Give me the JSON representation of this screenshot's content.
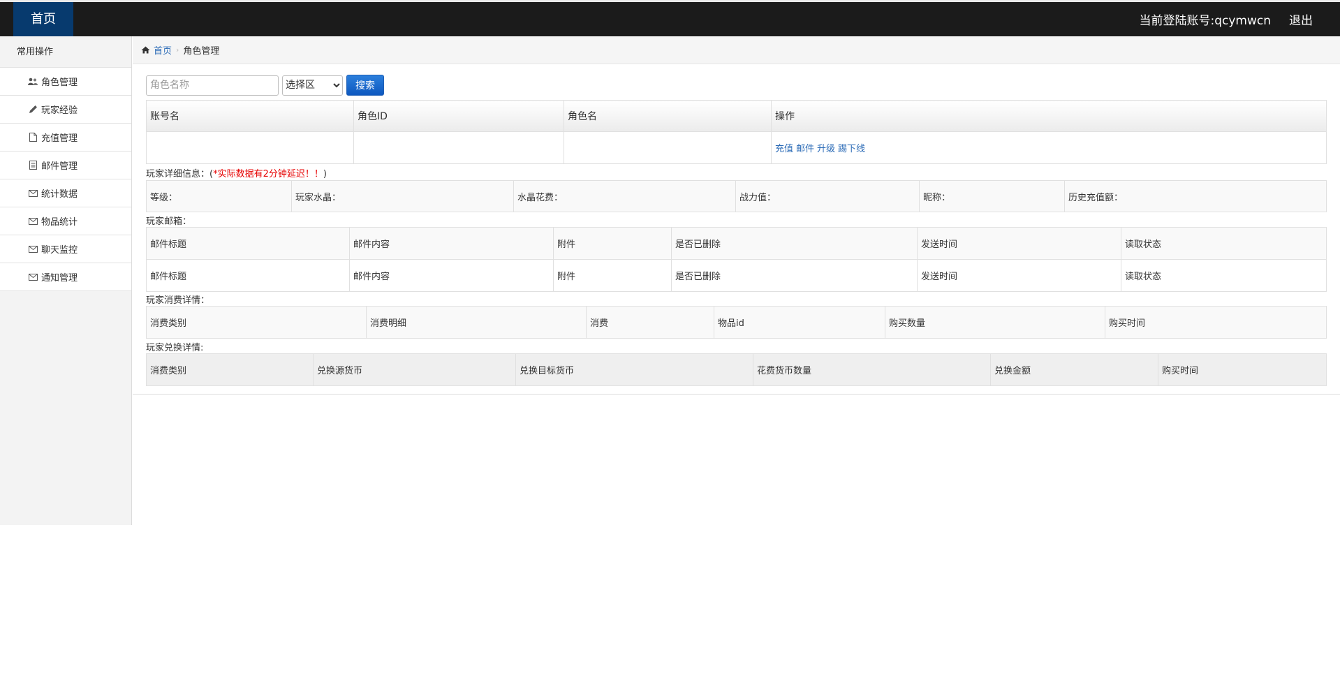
{
  "topbar": {
    "brand": "首页",
    "account": "当前登陆账号:qcymwcn",
    "logout": "退出"
  },
  "sidebar": {
    "header": "常用操作",
    "items": [
      {
        "label": "角色管理",
        "icon": "users-icon"
      },
      {
        "label": "玩家经验",
        "icon": "pencil-icon"
      },
      {
        "label": "充值管理",
        "icon": "file-icon"
      },
      {
        "label": "邮件管理",
        "icon": "list-icon"
      },
      {
        "label": "统计数据",
        "icon": "envelope-icon"
      },
      {
        "label": "物品统计",
        "icon": "envelope-icon"
      },
      {
        "label": "聊天监控",
        "icon": "envelope-icon"
      },
      {
        "label": "通知管理",
        "icon": "envelope-icon"
      }
    ]
  },
  "breadcrumb": {
    "home": "首页",
    "current": "角色管理"
  },
  "search": {
    "placeholder": "角色名称",
    "select_value": "选择区",
    "button": "搜索"
  },
  "role_table": {
    "headers": [
      "账号名",
      "角色ID",
      "角色名",
      "操作"
    ],
    "actions": [
      "充值",
      "邮件",
      "升级",
      "踢下线"
    ]
  },
  "detail": {
    "label_prefix": "玩家详细信息：(",
    "label_warning": "*实际数据有2分钟延迟！！",
    "label_suffix": ")",
    "fields": [
      "等级：",
      "玩家水晶：",
      "水晶花费：",
      "战力值：",
      "昵称：",
      "历史充值额："
    ]
  },
  "mail": {
    "label": "玩家邮箱：",
    "headers": [
      "邮件标题",
      "邮件内容",
      "附件",
      "是否已删除",
      "发送时间",
      "读取状态"
    ],
    "row": [
      "邮件标题",
      "邮件内容",
      "附件",
      "是否已删除",
      "发送时间",
      "读取状态"
    ]
  },
  "consume": {
    "label": "玩家消费详情：",
    "headers": [
      "消费类别",
      "消费明细",
      "消费",
      "物品id",
      "购买数量",
      "购买时间"
    ]
  },
  "exchange": {
    "label": "玩家兑换详情:",
    "headers": [
      "消费类别",
      "兑换源货币",
      "兑换目标货币",
      "花费货币数量",
      "兑换金额",
      "购买时间"
    ]
  }
}
